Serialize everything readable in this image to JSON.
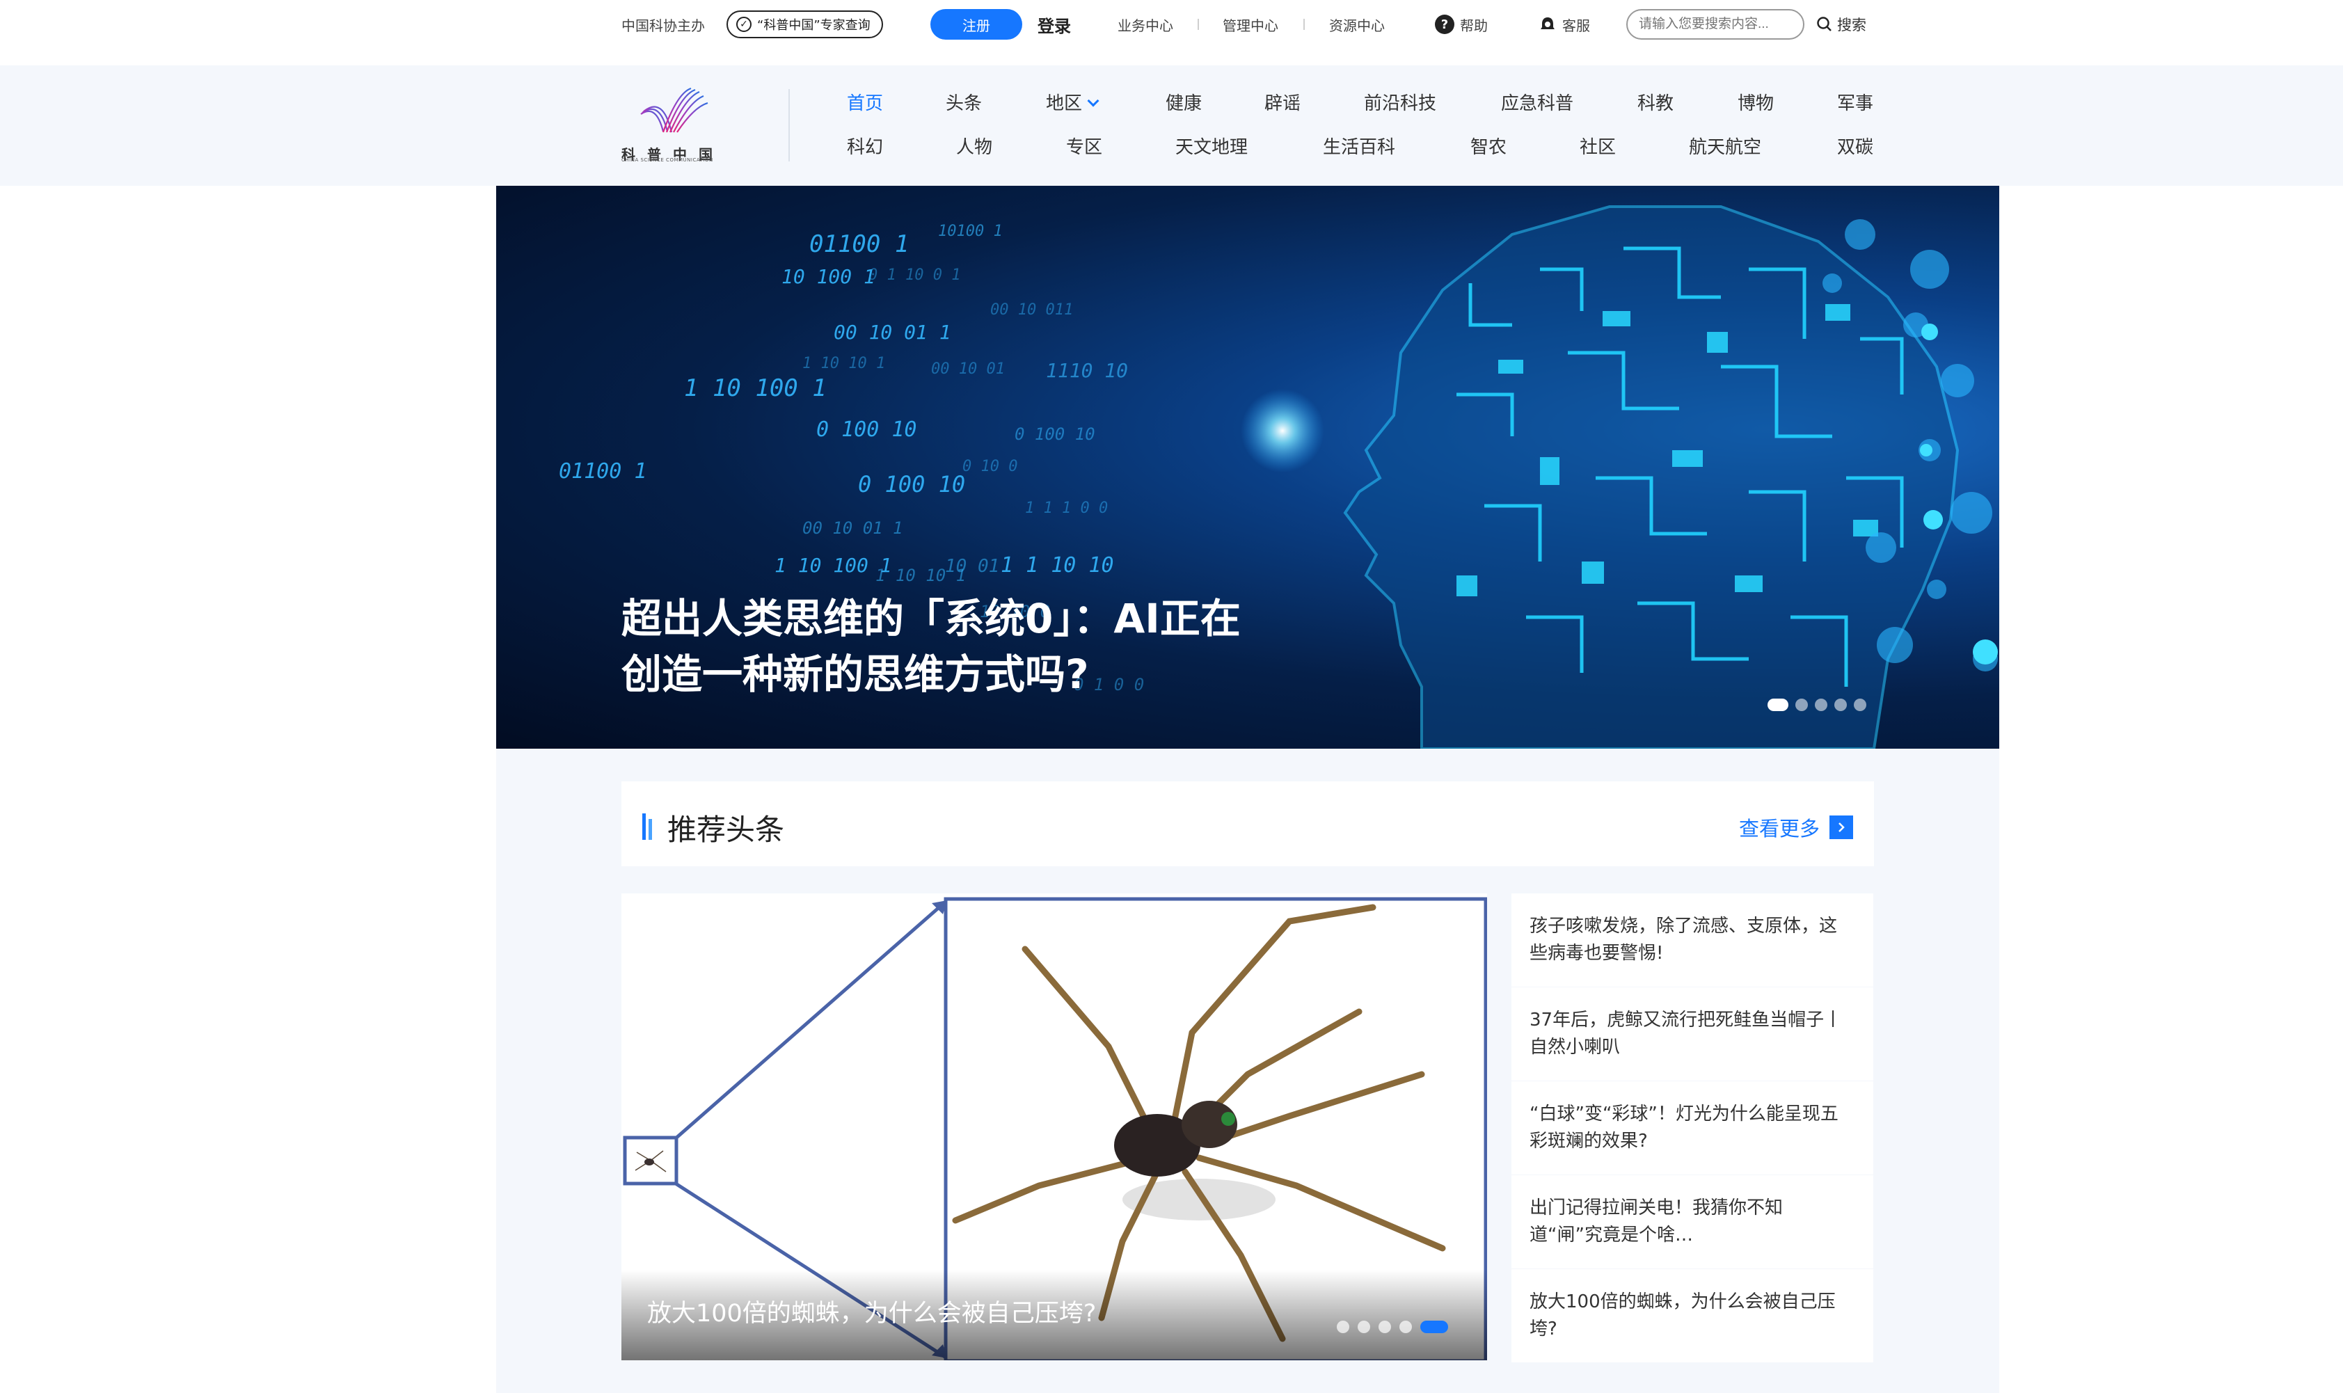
{
  "topbar": {
    "sponsor": "中国科协主办",
    "expert_query": "“科普中国”专家查询",
    "register": "注册",
    "login": "登录",
    "business_center": "业务中心",
    "management_center": "管理中心",
    "resource_center": "资源中心",
    "help": "帮助",
    "customer_service": "客服",
    "search_placeholder": "请输入您要搜索内容...",
    "search": "搜索"
  },
  "logo": {
    "name": "科普中国",
    "subtitle": "CHINA SCIENCE COMMUNICATION"
  },
  "nav": {
    "row1": [
      "首页",
      "头条",
      "地区",
      "健康",
      "辟谣",
      "前沿科技",
      "应急科普",
      "科教",
      "博物",
      "军事"
    ],
    "row2": [
      "科幻",
      "人物",
      "专区",
      "天文地理",
      "生活百科",
      "智农",
      "社区",
      "航天航空",
      "双碳"
    ],
    "active": "首页"
  },
  "banner": {
    "title_line1": "超出人类思维的「系统0」：AI正在",
    "title_line2": "创造一种新的思维方式吗?",
    "slide_count": 5,
    "active_slide": 1
  },
  "recommended": {
    "title": "推荐头条",
    "more": "查看更多",
    "feature": {
      "title": "放大100倍的蜘蛛，为什么会被自己压垮?",
      "slide_count": 5,
      "active_slide": 5
    },
    "items": [
      "孩子咳嗽发烧，除了流感、支原体，这些病毒也要警惕!",
      "37年后，虎鲸又流行把死鲑鱼当帽子丨自然小喇叭",
      "“白球”变“彩球”！灯光为什么能呈现五彩斑斓的效果?",
      "出门记得拉闸关电！我猜你不知道“闸”究竟是个啥…",
      "放大100倍的蜘蛛，为什么会被自己压垮?"
    ]
  },
  "colors": {
    "accent": "#1677ff",
    "header_bg": "#f4f7fc",
    "banner_dark": "#051f48"
  },
  "icons": [
    "check-icon",
    "help-icon",
    "service-icon",
    "search-icon",
    "logo-icon",
    "chevron-down-icon",
    "arrow-right-icon"
  ]
}
